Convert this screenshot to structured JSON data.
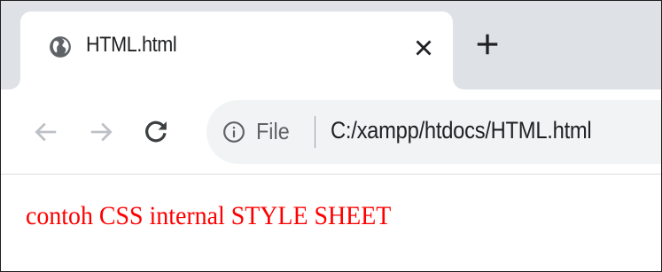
{
  "tab": {
    "title": "HTML.html",
    "favicon": "globe-icon",
    "close_icon": "close-icon",
    "new_tab_icon": "plus-icon"
  },
  "toolbar": {
    "back_icon": "arrow-left-icon",
    "forward_icon": "arrow-right-icon",
    "reload_icon": "reload-icon"
  },
  "omnibox": {
    "security_icon": "info-icon",
    "chip_label": "File",
    "url": "C:/xampp/htdocs/HTML.html"
  },
  "page": {
    "text": "contoh CSS internal STYLE SHEET",
    "text_color": "#ff0000"
  },
  "colors": {
    "tabstrip_bg": "#dee1e6",
    "omnibox_bg": "#f1f3f4",
    "icon": "#5f6368",
    "icon_disabled": "#bdc1c6"
  }
}
